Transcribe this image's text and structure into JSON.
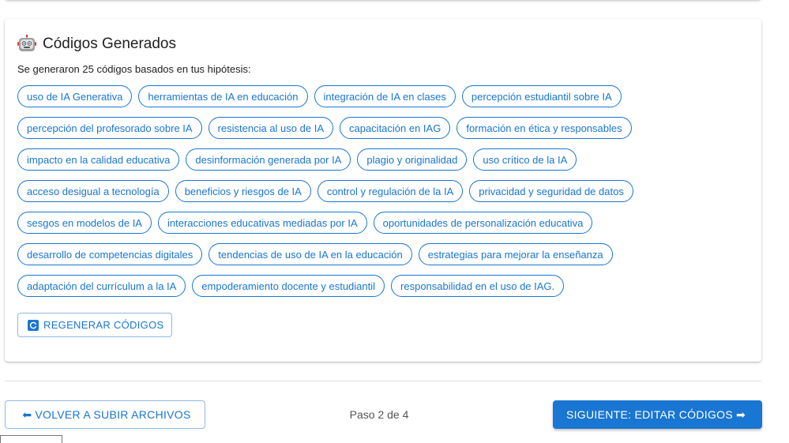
{
  "card": {
    "icon": "robot-icon",
    "title": "Códigos Generados",
    "subtitle": "Se generaron 25 códigos basados en tus hipótesis:",
    "codes": [
      "uso de IA Generativa",
      "herramientas de IA en educación",
      "integración de IA en clases",
      "percepción estudiantil sobre IA",
      "percepción del profesorado sobre IA",
      "resistencia al uso de IA",
      "capacitación en IAG",
      "formación en ética y responsables",
      "impacto en la calidad educativa",
      "desinformación generada por IA",
      "plagio y originalidad",
      "uso crítico de la IA",
      "acceso desigual a tecnología",
      "beneficios y riesgos de IA",
      "control y regulación de la IA",
      "privacidad y seguridad de datos",
      "sesgos en modelos de IA",
      "interacciones educativas mediadas por IA",
      "oportunidades de personalización educativa",
      "desarrollo de competencias digitales",
      "tendencias de uso de IA en la educación",
      "estrategias para mejorar la enseñanza",
      "adaptación del currículum a la IA",
      "empoderamiento docente y estudiantil",
      "responsabilidad en el uso de IAG."
    ],
    "regenerate_label": "REGENERAR CÓDIGOS",
    "regenerate_icon": "refresh-icon"
  },
  "footer": {
    "back_label": "VOLVER A SUBIR ARCHIVOS",
    "back_icon": "arrow-left-icon",
    "step_text": "Paso 2 de 4",
    "next_label": "SIGUIENTE: EDITAR CÓDIGOS",
    "next_icon": "arrow-right-icon"
  },
  "colors": {
    "primary": "#1976d2",
    "text": "#212121",
    "muted": "#555555"
  }
}
